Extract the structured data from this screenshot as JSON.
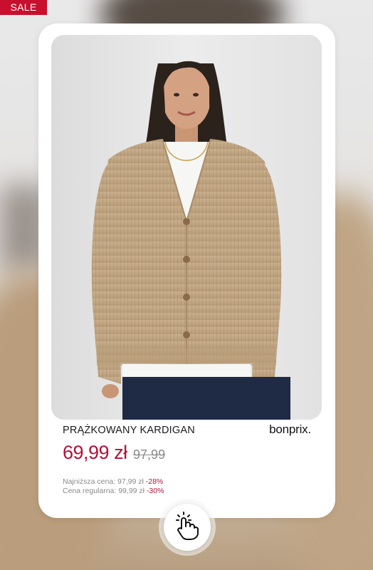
{
  "badge": {
    "sale": "SALE"
  },
  "product": {
    "name": "PRĄŻKOWANY KARDIGAN",
    "brand": "bonprix.",
    "price": "69,99 zł",
    "old_price": "97,99",
    "lowest_label": "Najniższa cena: 97,99 zł",
    "lowest_discount": "-28%",
    "regular_label": "Cena regularna: 99,99 zł",
    "regular_discount": "-30%"
  },
  "colors": {
    "sale_red": "#c8102e",
    "price_red": "#b3123a",
    "cardigan": "#c3a885"
  },
  "icons": {
    "tap": "hand-tap-icon"
  }
}
